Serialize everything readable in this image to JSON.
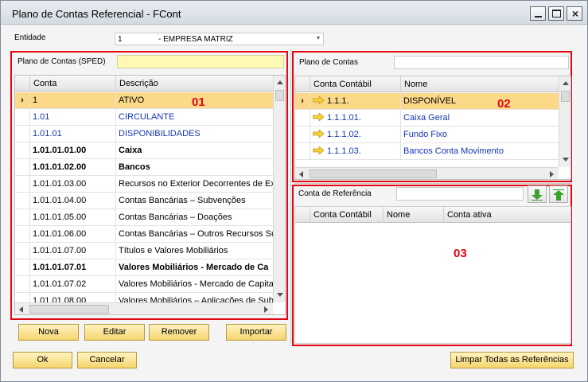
{
  "window": {
    "title": "Plano de Contas Referencial - FCont"
  },
  "entidade": {
    "label": "Entidade",
    "code": "1",
    "name": "- EMPRESA MATRIZ"
  },
  "left_panel": {
    "label": "Plano de Contas (SPED)",
    "marker": "01",
    "columns": [
      "Conta",
      "Descrição"
    ],
    "rows": [
      {
        "conta": "1",
        "descricao": "ATIVO",
        "style": "selected"
      },
      {
        "conta": "1.01",
        "descricao": "CIRCULANTE",
        "style": "link"
      },
      {
        "conta": "1.01.01",
        "descricao": "DISPONIBILIDADES",
        "style": "link"
      },
      {
        "conta": "1.01.01.01.00",
        "descricao": "Caixa",
        "style": "bold"
      },
      {
        "conta": "1.01.01.02.00",
        "descricao": "Bancos",
        "style": "bold"
      },
      {
        "conta": "1.01.01.03.00",
        "descricao": "Recursos no Exterior Decorrentes de Exp",
        "style": "normal"
      },
      {
        "conta": "1.01.01.04.00",
        "descricao": "Contas Bancárias – Subvenções",
        "style": "normal"
      },
      {
        "conta": "1.01.01.05.00",
        "descricao": "Contas Bancárias – Doações",
        "style": "normal"
      },
      {
        "conta": "1.01.01.06.00",
        "descricao": "Contas Bancárias – Outros Recursos Suje",
        "style": "normal"
      },
      {
        "conta": "1.01.01.07.00",
        "descricao": "Títulos e Valores Mobiliários",
        "style": "normal"
      },
      {
        "conta": "1.01.01.07.01",
        "descricao": "Valores Mobiliários - Mercado de Ca",
        "style": "bold"
      },
      {
        "conta": "1.01.01.07.02",
        "descricao": "Valores Mobiliários - Mercado de Capitais",
        "style": "normal"
      },
      {
        "conta": "1.01.01.08.00",
        "descricao": "Valores Mobiliários – Aplicações de Subve",
        "style": "normal"
      }
    ]
  },
  "right_top_panel": {
    "label": "Plano de Contas",
    "marker": "02",
    "columns": [
      "Conta Contábil",
      "Nome"
    ],
    "rows": [
      {
        "conta": "1.1.1.",
        "nome": "DISPONÍVEL",
        "style": "selected"
      },
      {
        "conta": "1.1.1.01.",
        "nome": "Caixa Geral",
        "style": "link"
      },
      {
        "conta": "1.1.1.02.",
        "nome": "Fundo Fixo",
        "style": "link"
      },
      {
        "conta": "1.1.1.03.",
        "nome": "Bancos Conta Movimento",
        "style": "link"
      }
    ]
  },
  "right_bottom_panel": {
    "label": "Conta de Referência",
    "marker": "03",
    "columns": [
      "Conta Contábil",
      "Nome",
      "Conta ativa"
    ],
    "down_icon": "green-down-arrow-icon",
    "up_icon": "green-up-arrow-icon"
  },
  "buttons": {
    "nova": "Nova",
    "editar": "Editar",
    "remover": "Remover",
    "importar": "Importar",
    "ok": "Ok",
    "cancelar": "Cancelar",
    "limpar": "Limpar Todas as Referências"
  },
  "colors": {
    "highlight_box": "#e10613",
    "selected_row": "#fcd889",
    "link_text": "#1736b4",
    "button_bg": "#f5d56e",
    "input_yellow": "#fff9b4"
  }
}
